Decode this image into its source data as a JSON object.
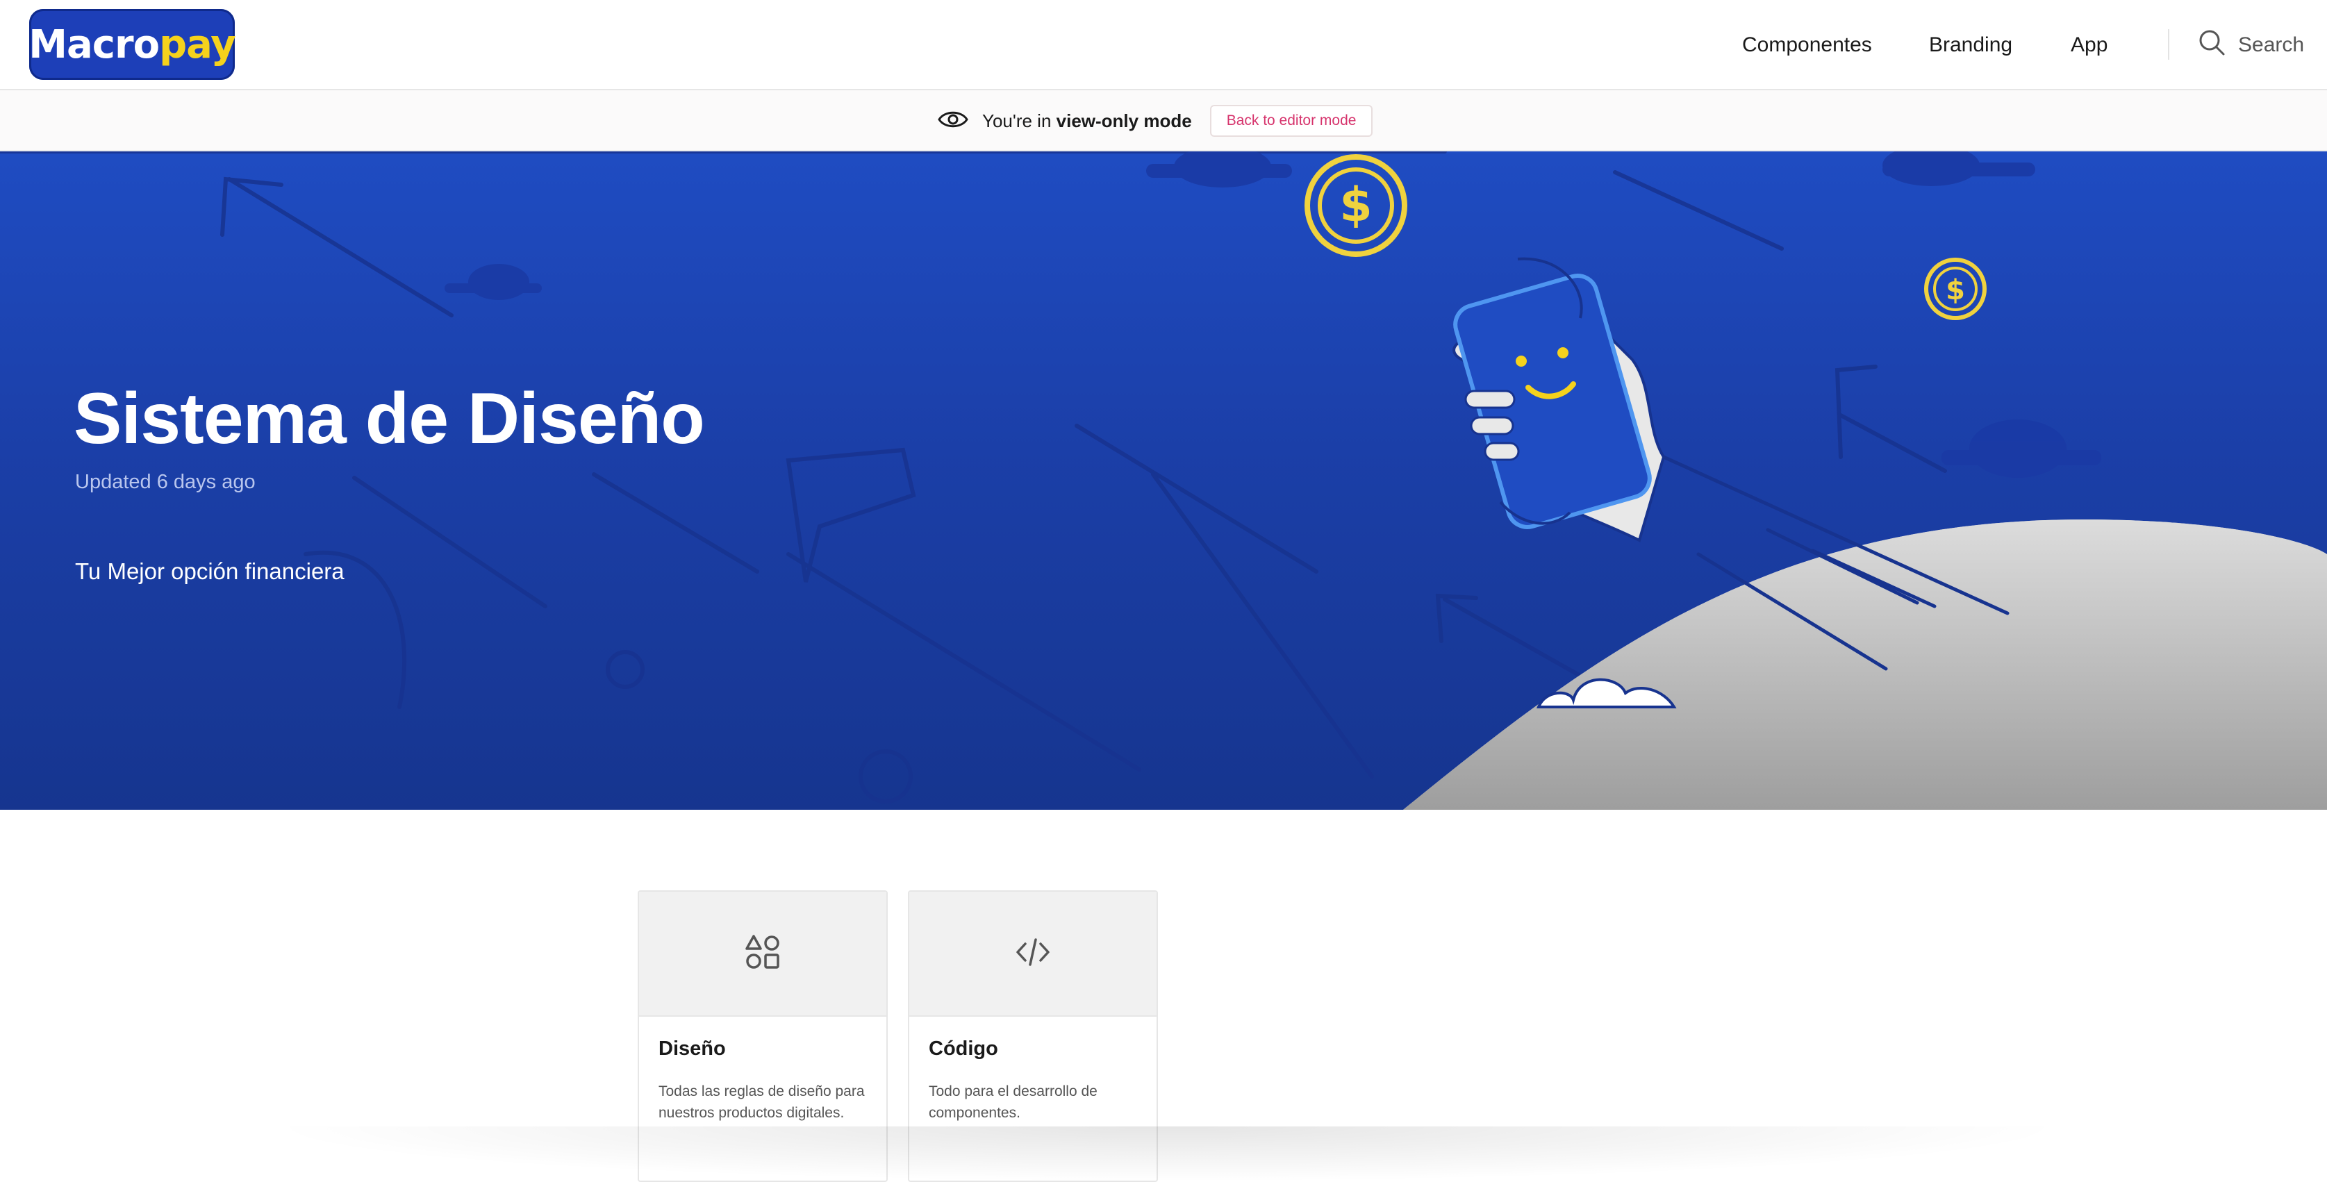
{
  "header": {
    "logo": {
      "text_a": "Macro",
      "text_b": "pay"
    },
    "nav": [
      {
        "label": "Componentes"
      },
      {
        "label": "Branding"
      },
      {
        "label": "App"
      }
    ],
    "search_label": "Search"
  },
  "viewbar": {
    "prefix": "You're in ",
    "mode": "view-only mode",
    "button_label": "Back to editor mode"
  },
  "hero": {
    "title": "Sistema de Diseño",
    "updated": "Updated 6 days ago",
    "tagline": "Tu Mejor opción financiera"
  },
  "cards": [
    {
      "icon": "shapes-icon",
      "title": "Diseño",
      "description": "Todas las reglas de diseño para nuestros productos digitales."
    },
    {
      "icon": "code-icon",
      "title": "Código",
      "description": "Todo para el desarrollo de componentes."
    }
  ],
  "colors": {
    "brand_blue": "#1d3fb8",
    "brand_yellow": "#f5d21c",
    "accent_pink": "#d6336c"
  }
}
